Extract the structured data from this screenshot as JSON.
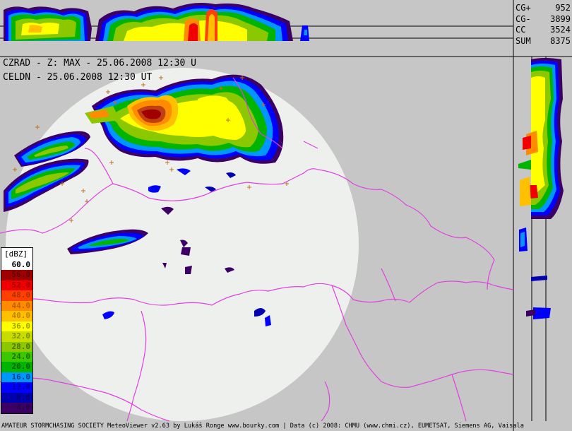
{
  "overlay": {
    "line1": "CZRAD - Z: MAX - 25.06.2008 12:30 U",
    "line2": "CELDN - 25.06.2008 12:30 UT"
  },
  "lightning_stats": [
    {
      "label": "CG+",
      "value": "952"
    },
    {
      "label": "CG-",
      "value": "3899"
    },
    {
      "label": "CC",
      "value": "3524"
    },
    {
      "label": "SUM",
      "value": "8375"
    }
  ],
  "legend": {
    "title": "[dBZ]",
    "steps": [
      {
        "value": "60.0",
        "color": "#ffffff",
        "text_color": "#000000"
      },
      {
        "value": "56.0",
        "color": "#a00000",
        "text_color": "#600000"
      },
      {
        "value": "52.0",
        "color": "#f00000",
        "text_color": "#a00000"
      },
      {
        "value": "48.0",
        "color": "#ff4000",
        "text_color": "#b03000"
      },
      {
        "value": "44.0",
        "color": "#ff8c00",
        "text_color": "#c06000"
      },
      {
        "value": "40.0",
        "color": "#ffc000",
        "text_color": "#c08000"
      },
      {
        "value": "36.0",
        "color": "#ffff00",
        "text_color": "#a0a000"
      },
      {
        "value": "32.0",
        "color": "#c8dc00",
        "text_color": "#809000"
      },
      {
        "value": "28.0",
        "color": "#8cc800",
        "text_color": "#507000"
      },
      {
        "value": "24.0",
        "color": "#3cc800",
        "text_color": "#207000"
      },
      {
        "value": "20.0",
        "color": "#00b400",
        "text_color": "#006000"
      },
      {
        "value": "16.0",
        "color": "#0096ff",
        "text_color": "#004080"
      },
      {
        "value": "12.0",
        "color": "#0000ff",
        "text_color": "#0000a0"
      },
      {
        "value": "8.0",
        "color": "#0000b0",
        "text_color": "#000070"
      },
      {
        "value": "4.0",
        "color": "#3c0064",
        "text_color": "#200040"
      }
    ]
  },
  "footer": "AMATEUR STORMCHASING SOCIETY MeteoViewer v2.63 by Lukáš Ronge www.bourky.com | Data (c) 2008: CHMU (www.chmi.cz), EUMETSAT, Siemens AG, Vaisala",
  "colors": {
    "background": "#c6c6c6",
    "radar_disc": "#eef0ee",
    "border_lines": "#e040e0"
  }
}
